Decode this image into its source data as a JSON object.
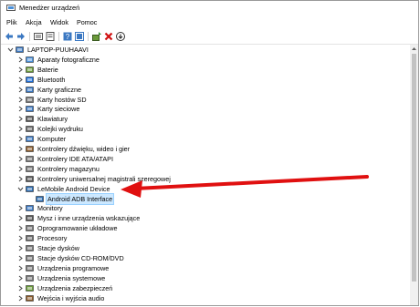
{
  "window": {
    "title": "Menedżer urządzeń"
  },
  "menu": [
    "Plik",
    "Akcja",
    "Widok",
    "Pomoc"
  ],
  "toolbar": [
    "back-arrow-icon",
    "forward-arrow-icon",
    "show-hidden-icon",
    "properties-icon",
    "help-icon",
    "view-icon",
    "update-driver-icon",
    "uninstall-icon",
    "scan-hardware-icon"
  ],
  "tree": {
    "root": "LAPTOP-PUUHAAVI",
    "items": [
      {
        "label": "Aparaty fotograficzne",
        "icon": "camera-icon",
        "expanded": false
      },
      {
        "label": "Baterie",
        "icon": "battery-icon",
        "expanded": false
      },
      {
        "label": "Bluetooth",
        "icon": "bluetooth-icon",
        "expanded": false
      },
      {
        "label": "Karty graficzne",
        "icon": "display-adapter-icon",
        "expanded": false
      },
      {
        "label": "Karty hostów SD",
        "icon": "sd-host-icon",
        "expanded": false
      },
      {
        "label": "Karty sieciowe",
        "icon": "network-adapter-icon",
        "expanded": false
      },
      {
        "label": "Klawiatury",
        "icon": "keyboard-icon",
        "expanded": false
      },
      {
        "label": "Kolejki wydruku",
        "icon": "printer-icon",
        "expanded": false
      },
      {
        "label": "Komputer",
        "icon": "computer-icon",
        "expanded": false
      },
      {
        "label": "Kontrolery dźwięku, wideo i gier",
        "icon": "sound-icon",
        "expanded": false
      },
      {
        "label": "Kontrolery IDE ATA/ATAPI",
        "icon": "ide-controller-icon",
        "expanded": false
      },
      {
        "label": "Kontrolery magazynu",
        "icon": "storage-controller-icon",
        "expanded": false
      },
      {
        "label": "Kontrolery uniwersalnej magistrali szeregowej",
        "icon": "usb-controller-icon",
        "expanded": false
      },
      {
        "label": "LeMobile Android Device",
        "icon": "android-device-icon",
        "expanded": true,
        "children": [
          {
            "label": "Android ADB Interface",
            "icon": "adb-interface-icon"
          }
        ]
      },
      {
        "label": "Monitory",
        "icon": "monitor-icon",
        "expanded": false
      },
      {
        "label": "Mysz i inne urządzenia wskazujące",
        "icon": "mouse-icon",
        "expanded": false
      },
      {
        "label": "Oprogramowanie układowe",
        "icon": "firmware-icon",
        "expanded": false
      },
      {
        "label": "Procesory",
        "icon": "processor-icon",
        "expanded": false
      },
      {
        "label": "Stacje dysków",
        "icon": "disk-drive-icon",
        "expanded": false
      },
      {
        "label": "Stacje dysków CD-ROM/DVD",
        "icon": "cdrom-icon",
        "expanded": false
      },
      {
        "label": "Urządzenia programowe",
        "icon": "software-device-icon",
        "expanded": false
      },
      {
        "label": "Urządzenia systemowe",
        "icon": "system-device-icon",
        "expanded": false
      },
      {
        "label": "Urządzenia zabezpieczeń",
        "icon": "security-device-icon",
        "expanded": false
      },
      {
        "label": "Wejścia i wyjścia audio",
        "icon": "audio-io-icon",
        "expanded": false
      }
    ]
  },
  "colors": {
    "annotation_arrow": "#e01010",
    "selection": "#cce8ff"
  }
}
